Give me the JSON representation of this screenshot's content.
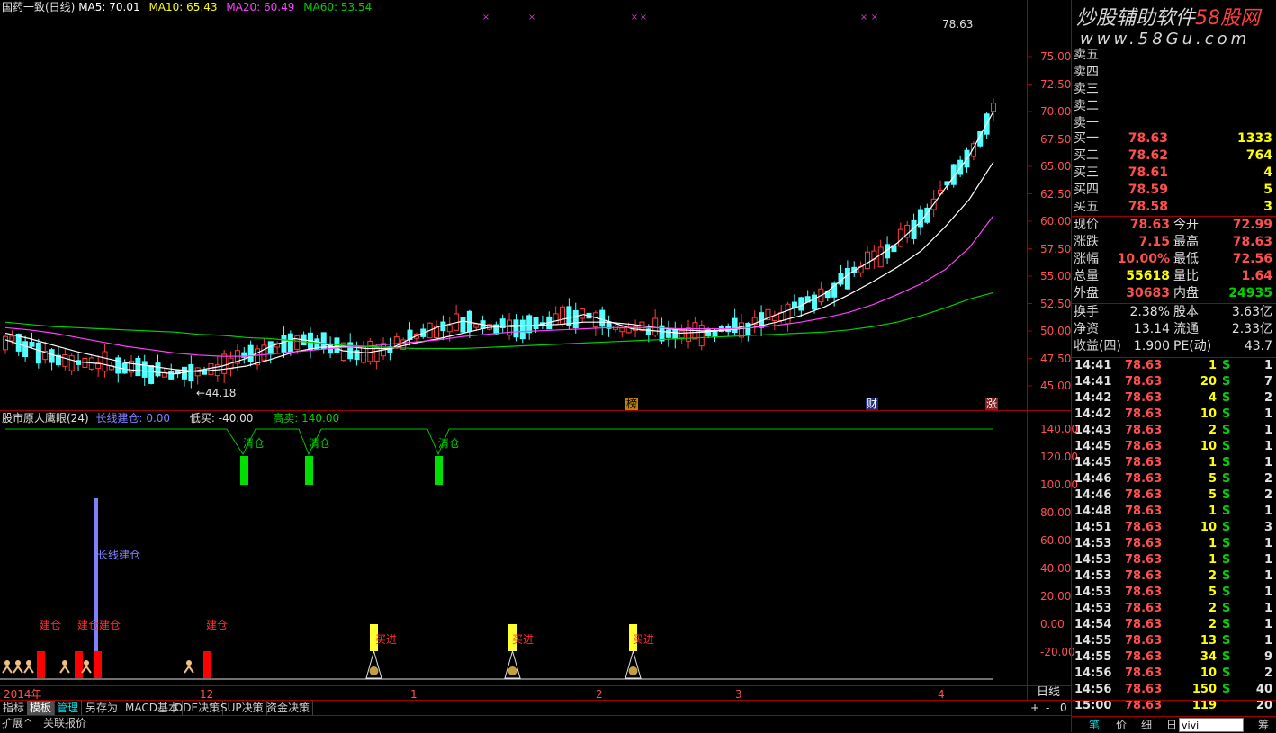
{
  "header": {
    "name": "国药一致(日线)",
    "ma5": "MA5: 70.01",
    "ma10": "MA10: 65.43",
    "ma20": "MA20: 60.49",
    "ma60": "MA60: 53.54",
    "max_label": "78.63",
    "min_label": "44.18"
  },
  "watermark": {
    "line1": "炒股辅助软件",
    "brand": "58股网",
    "url": "www.58Gu.com"
  },
  "price_axis": [
    "75.00",
    "72.50",
    "70.00",
    "67.50",
    "65.00",
    "62.50",
    "60.00",
    "57.50",
    "55.00",
    "52.50",
    "50.00",
    "47.50",
    "45.00"
  ],
  "events": [
    {
      "text": "榜",
      "color": "#ffb000"
    },
    {
      "text": "财",
      "color": "#40a0ff"
    },
    {
      "text": "涨",
      "color": "#ff6060"
    }
  ],
  "indicator": {
    "title": "股市原人鹰眼(24)",
    "long": "长线建仓: 0.00",
    "low": "低买: -40.00",
    "high": "高卖: 140.00",
    "qingcang": "清仓",
    "long_label": "长线建仓",
    "build": "建仓",
    "build_double": "建仓建仓",
    "buy": "买进",
    "axis": [
      "140.00",
      "120.00",
      "100.00",
      "80.00",
      "60.00",
      "40.00",
      "20.00",
      "0.00",
      "-20.00"
    ]
  },
  "date_axis": {
    "year": "2014年",
    "months": [
      "12",
      "1",
      "2",
      "3",
      "4"
    ],
    "period": "日线"
  },
  "toolbar": [
    "指标",
    "模板",
    "管理",
    "另存为",
    "MACD基本",
    "DDE决策",
    "SUP决策",
    "资金决策"
  ],
  "bottom_bar": [
    "扩展^",
    "关联报价"
  ],
  "zoom": [
    "+",
    "-",
    "0"
  ],
  "panel": {
    "sell": [
      {
        "label": "卖五"
      },
      {
        "label": "卖四"
      },
      {
        "label": "卖三"
      },
      {
        "label": "卖二"
      },
      {
        "label": "卖一"
      }
    ],
    "buy": [
      {
        "label": "买一",
        "price": "78.63",
        "vol": "1333"
      },
      {
        "label": "买二",
        "price": "78.62",
        "vol": "764"
      },
      {
        "label": "买三",
        "price": "78.61",
        "vol": "4"
      },
      {
        "label": "买四",
        "price": "78.59",
        "vol": "5"
      },
      {
        "label": "买五",
        "price": "78.58",
        "vol": "3"
      }
    ],
    "quote": [
      {
        "l1": "现价",
        "v1": "78.63",
        "c1": "red",
        "l2": "今开",
        "v2": "72.99",
        "c2": "red"
      },
      {
        "l1": "涨跌",
        "v1": "7.15",
        "c1": "red",
        "l2": "最高",
        "v2": "78.63",
        "c2": "red"
      },
      {
        "l1": "涨幅",
        "v1": "10.00%",
        "c1": "red",
        "l2": "最低",
        "v2": "72.56",
        "c2": "red"
      },
      {
        "l1": "总量",
        "v1": "55618",
        "c1": "yel",
        "l2": "量比",
        "v2": "1.64",
        "c2": "red"
      },
      {
        "l1": "外盘",
        "v1": "30683",
        "c1": "red",
        "l2": "内盘",
        "v2": "24935",
        "c2": "grn"
      }
    ],
    "fund": [
      {
        "l1": "换手",
        "v1": "2.38%",
        "l2": "股本",
        "v2": "3.63亿"
      },
      {
        "l1": "净资",
        "v1": "13.14",
        "l2": "流通",
        "v2": "2.33亿"
      },
      {
        "l1": "收益(四)",
        "v1": "1.900",
        "l2": "PE(动)",
        "v2": "43.7"
      }
    ],
    "ticks": [
      {
        "t": "14:41",
        "p": "78.63",
        "v": "1",
        "s": "S",
        "n": "1"
      },
      {
        "t": "14:41",
        "p": "78.63",
        "v": "20",
        "s": "S",
        "n": "7"
      },
      {
        "t": "14:42",
        "p": "78.63",
        "v": "4",
        "s": "S",
        "n": "2"
      },
      {
        "t": "14:42",
        "p": "78.63",
        "v": "10",
        "s": "S",
        "n": "1"
      },
      {
        "t": "14:43",
        "p": "78.63",
        "v": "2",
        "s": "S",
        "n": "1"
      },
      {
        "t": "14:45",
        "p": "78.63",
        "v": "10",
        "s": "S",
        "n": "1"
      },
      {
        "t": "14:45",
        "p": "78.63",
        "v": "1",
        "s": "S",
        "n": "1"
      },
      {
        "t": "14:46",
        "p": "78.63",
        "v": "5",
        "s": "S",
        "n": "2"
      },
      {
        "t": "14:46",
        "p": "78.63",
        "v": "5",
        "s": "S",
        "n": "2"
      },
      {
        "t": "14:48",
        "p": "78.63",
        "v": "1",
        "s": "S",
        "n": "1"
      },
      {
        "t": "14:51",
        "p": "78.63",
        "v": "10",
        "s": "S",
        "n": "3"
      },
      {
        "t": "14:53",
        "p": "78.63",
        "v": "1",
        "s": "S",
        "n": "1"
      },
      {
        "t": "14:53",
        "p": "78.63",
        "v": "1",
        "s": "S",
        "n": "1"
      },
      {
        "t": "14:53",
        "p": "78.63",
        "v": "2",
        "s": "S",
        "n": "1"
      },
      {
        "t": "14:53",
        "p": "78.63",
        "v": "5",
        "s": "S",
        "n": "1"
      },
      {
        "t": "14:53",
        "p": "78.63",
        "v": "2",
        "s": "S",
        "n": "1"
      },
      {
        "t": "14:54",
        "p": "78.63",
        "v": "2",
        "s": "S",
        "n": "1"
      },
      {
        "t": "14:55",
        "p": "78.63",
        "v": "13",
        "s": "S",
        "n": "1"
      },
      {
        "t": "14:55",
        "p": "78.63",
        "v": "34",
        "s": "S",
        "n": "9"
      },
      {
        "t": "14:56",
        "p": "78.63",
        "v": "10",
        "s": "S",
        "n": "2"
      },
      {
        "t": "14:56",
        "p": "78.63",
        "v": "150",
        "s": "S",
        "n": "40"
      },
      {
        "t": "15:00",
        "p": "78.63",
        "v": "119",
        "s": "",
        "n": "20"
      }
    ],
    "bottom_tabs": [
      "笔",
      "价",
      "细",
      "日"
    ],
    "input_value": "vivi",
    "last_tab": "筹"
  },
  "chart_data": {
    "type": "candlestick",
    "ylim": [
      44,
      79
    ],
    "series": [
      {
        "name": "MA5",
        "color": "#ffffff",
        "values": [
          49.2,
          48.5,
          47.8,
          47.2,
          47.0,
          46.5,
          46.3,
          46.1,
          46.4,
          46.8,
          47.5,
          48.6,
          49.3,
          49.0,
          48.2,
          48.0,
          48.4,
          49.5,
          50.4,
          50.9,
          50.5,
          50.4,
          50.5,
          51.0,
          51.5,
          50.9,
          50.2,
          50.0,
          49.8,
          49.9,
          50.1,
          50.6,
          51.5,
          52.3,
          53.4,
          55.2,
          56.5,
          58.0,
          60.0,
          63.0,
          66.0,
          70.0
        ]
      },
      {
        "name": "MA10",
        "color": "#ffffff",
        "values": [
          49.8,
          49.3,
          48.7,
          48.1,
          47.6,
          47.1,
          46.8,
          46.5,
          46.3,
          46.5,
          46.8,
          47.4,
          48.1,
          48.5,
          48.6,
          48.4,
          48.4,
          48.9,
          49.3,
          49.8,
          50.3,
          50.5,
          50.5,
          50.6,
          50.8,
          50.8,
          50.6,
          50.3,
          50.1,
          50.0,
          50.1,
          50.3,
          50.8,
          51.4,
          52.2,
          53.3,
          54.5,
          55.8,
          57.3,
          59.5,
          62.0,
          65.4
        ]
      },
      {
        "name": "MA20",
        "color": "#ff40ff",
        "values": [
          50.3,
          50.1,
          49.8,
          49.4,
          49.0,
          48.6,
          48.3,
          48.0,
          47.8,
          47.7,
          47.7,
          47.9,
          48.1,
          48.3,
          48.5,
          48.6,
          48.8,
          49.0,
          49.2,
          49.5,
          49.7,
          49.9,
          50.0,
          50.1,
          50.2,
          50.3,
          50.3,
          50.3,
          50.2,
          50.2,
          50.2,
          50.3,
          50.5,
          50.8,
          51.2,
          51.7,
          52.4,
          53.3,
          54.3,
          55.6,
          57.6,
          60.5
        ]
      },
      {
        "name": "MA60",
        "color": "#00d000",
        "values": [
          50.8,
          50.6,
          50.4,
          50.3,
          50.2,
          50.1,
          50.0,
          49.9,
          49.7,
          49.6,
          49.4,
          49.3,
          49.1,
          48.9,
          48.7,
          48.6,
          48.5,
          48.4,
          48.4,
          48.4,
          48.5,
          48.6,
          48.7,
          48.8,
          48.9,
          49.0,
          49.1,
          49.2,
          49.3,
          49.4,
          49.5,
          49.6,
          49.7,
          49.8,
          49.9,
          50.1,
          50.4,
          50.8,
          51.4,
          52.1,
          52.9,
          53.5
        ]
      }
    ]
  }
}
